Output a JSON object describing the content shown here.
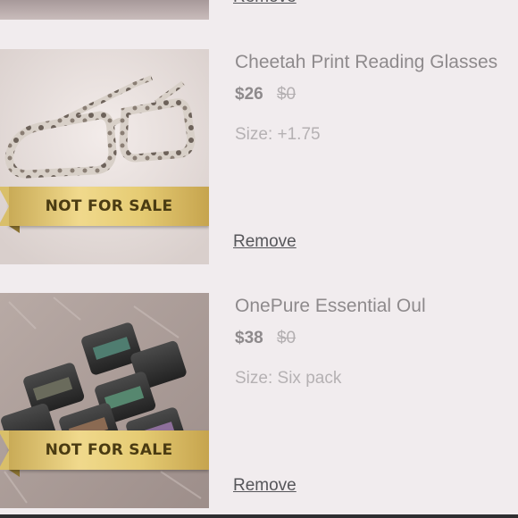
{
  "top_item": {
    "remove_label": "Remove"
  },
  "items": [
    {
      "title": "Cheetah Print Reading Glasses",
      "price": "$26",
      "original_price": "$0",
      "size": "Size: +1.75",
      "ribbon": "NOT FOR SALE",
      "remove_label": "Remove",
      "image": "cheetah-print-glasses-photo"
    },
    {
      "title": "OnePure Essential Oul",
      "price": "$38",
      "original_price": "$0",
      "size": "Size: Six pack",
      "ribbon": "NOT FOR SALE",
      "remove_label": "Remove",
      "image": "essential-oil-bottles-photo"
    }
  ]
}
